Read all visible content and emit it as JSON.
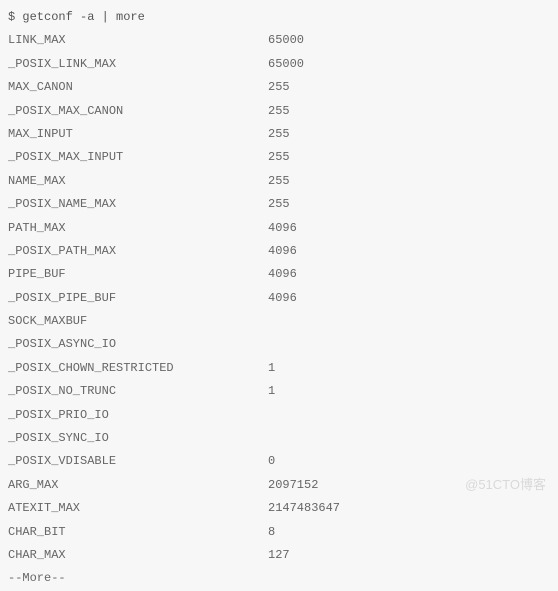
{
  "command_line": "$ getconf -a | more",
  "rows": [
    {
      "name": "LINK_MAX",
      "value": "65000"
    },
    {
      "name": "_POSIX_LINK_MAX",
      "value": "65000"
    },
    {
      "name": "MAX_CANON",
      "value": "255"
    },
    {
      "name": "_POSIX_MAX_CANON",
      "value": "255"
    },
    {
      "name": "MAX_INPUT",
      "value": "255"
    },
    {
      "name": "_POSIX_MAX_INPUT",
      "value": "255"
    },
    {
      "name": "NAME_MAX",
      "value": "255"
    },
    {
      "name": "_POSIX_NAME_MAX",
      "value": "255"
    },
    {
      "name": "PATH_MAX",
      "value": "4096"
    },
    {
      "name": "_POSIX_PATH_MAX",
      "value": "4096"
    },
    {
      "name": "PIPE_BUF",
      "value": "4096"
    },
    {
      "name": "_POSIX_PIPE_BUF",
      "value": "4096"
    },
    {
      "name": "SOCK_MAXBUF",
      "value": ""
    },
    {
      "name": "_POSIX_ASYNC_IO",
      "value": ""
    },
    {
      "name": "_POSIX_CHOWN_RESTRICTED",
      "value": "1"
    },
    {
      "name": "_POSIX_NO_TRUNC",
      "value": "1"
    },
    {
      "name": "_POSIX_PRIO_IO",
      "value": ""
    },
    {
      "name": "_POSIX_SYNC_IO",
      "value": ""
    },
    {
      "name": "_POSIX_VDISABLE",
      "value": "0"
    },
    {
      "name": "ARG_MAX",
      "value": "2097152"
    },
    {
      "name": "ATEXIT_MAX",
      "value": "2147483647"
    },
    {
      "name": "CHAR_BIT",
      "value": "8"
    },
    {
      "name": "CHAR_MAX",
      "value": "127"
    }
  ],
  "more_prompt": "--More--",
  "watermark": "@51CTO博客"
}
